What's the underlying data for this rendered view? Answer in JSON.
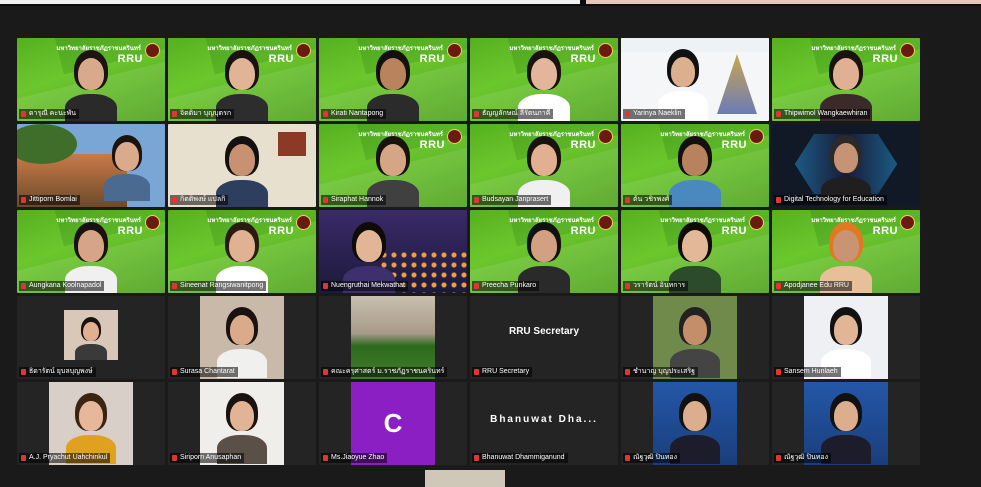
{
  "meeting": {
    "participants": [
      {
        "name": "ดารุณี คะนะพัน",
        "bg": "green",
        "skin": "#d8a98a",
        "hair": "#1c1410",
        "shirt": "#2a2a2a"
      },
      {
        "name": "จิตติมา บุญบุตรก",
        "bg": "green",
        "active": true,
        "skin": "#e0b595",
        "hair": "#1a1210",
        "shirt": "#2d2d2d"
      },
      {
        "name": "Kirati Nantapong",
        "bg": "green",
        "skin": "#b9835e",
        "hair": "#151010",
        "shirt": "#2b2b2b"
      },
      {
        "name": "ธัญญลักษณ์ ลีรัตนภาคี",
        "bg": "green",
        "skin": "#e3b69b",
        "hair": "#1a120e",
        "shirt": "#ffffff"
      },
      {
        "name": "Yarinya Naeklin",
        "bg": "light",
        "skin": "#dcb08e",
        "hair": "#111111",
        "shirt": "#ffffff"
      },
      {
        "name": "Thipwimol Wangkaewhiran",
        "bg": "green",
        "skin": "#e1b092",
        "hair": "#1a120e",
        "shirt": "#3a2a2a"
      },
      {
        "name": "Jittiporn Bomlai",
        "bg": "photo",
        "skin": "#d9ab8c",
        "hair": "#1b140e",
        "shirt": "#4a6a90"
      },
      {
        "name": "กิตติพงษ์ แปลกิ",
        "bg": "room",
        "skin": "#c89272",
        "hair": "#141010",
        "shirt": "#2e3e5e"
      },
      {
        "name": "Siraphat Hannok",
        "bg": "green",
        "skin": "#d5a686",
        "hair": "#1a120e",
        "shirt": "#404040"
      },
      {
        "name": "Budsayan Janprasert",
        "bg": "green",
        "skin": "#e0b090",
        "hair": "#1a120e",
        "shirt": "#f0f0f0"
      },
      {
        "name": "ต้น วชิรพงศ์",
        "bg": "green",
        "skin": "#b8825e",
        "hair": "#141010",
        "shirt": "#4a89c0"
      },
      {
        "name": "Digital Technology for Education",
        "bg": "tech",
        "skin": "#c69474",
        "hair": "#2a2a2a",
        "shirt": "#1f1f1f"
      },
      {
        "name": "Aungkana Koolnapadol",
        "bg": "green",
        "skin": "#d6a588",
        "hair": "#1a120e",
        "shirt": "#f0f0f0"
      },
      {
        "name": "Sineenat Rangsiwanitpong",
        "bg": "green",
        "skin": "#e1b194",
        "hair": "#2b1a10",
        "shirt": "#ffffff"
      },
      {
        "name": "Nuengruthai Mekwathat",
        "bg": "lights",
        "skin": "#e2b597",
        "hair": "#0f0b09",
        "shirt": "#3e2f6e"
      },
      {
        "name": "Preecha Punkaro",
        "bg": "green",
        "skin": "#d1a181",
        "hair": "#111111",
        "shirt": "#2a2a2a"
      },
      {
        "name": "วรารัตน์ อินทการ",
        "bg": "green",
        "skin": "#e3b898",
        "hair": "#100c0a",
        "shirt": "#2b4b2b"
      },
      {
        "name": "Apodjanee Edu RRU",
        "bg": "green",
        "skin": "#c99474",
        "hair": "#e07a20",
        "shirt": "#e7c09a"
      },
      {
        "name": "ธิดารัตน์ ยุบลบุญพงษ์",
        "bg": "small",
        "skin": "#e0b091",
        "hair": "#1a1210",
        "shirt": "#3a3a3a"
      },
      {
        "name": "Surasa Chantarat",
        "bg": "uniform",
        "skin": "#dbaa8b",
        "hair": "#1a1210",
        "shirt": "#f0f0ee"
      },
      {
        "name": "คณะครุศาสตร์ ม.ราชภัฏราชนครินทร์",
        "bg": "building",
        "skin": "",
        "hair": "",
        "shirt": ""
      },
      {
        "name": "RRU Secretary",
        "bg": "text",
        "label": "RRU Secretary"
      },
      {
        "name": "ชำนาญ บุญประเสริฐ",
        "bg": "photo2",
        "skin": "#c58e6b",
        "hair": "#222222",
        "shirt": "#444444"
      },
      {
        "name": "Sansem Hunlaeh",
        "bg": "portrait",
        "skin": "#e2b596",
        "hair": "#111111",
        "shirt": "#ffffff"
      },
      {
        "name": "A.J. Pryachut Uahchinkul",
        "bg": "portrait2",
        "skin": "#e6b79a",
        "hair": "#3a2412",
        "shirt": "#e0a020"
      },
      {
        "name": "Siriporn Anusaphan",
        "bg": "portrait3",
        "skin": "#e1b496",
        "hair": "#1a1210",
        "shirt": "#5a5048"
      },
      {
        "name": "Ms.Jiaoyue Zhao",
        "bg": "avatar",
        "letter": "C"
      },
      {
        "name": "Bhanuwat Dhammiganund",
        "bg": "text",
        "label": "Bhanuwat  Dha..."
      },
      {
        "name": "ณัฐวุฒิ ปิ่นทอง",
        "bg": "blueportrait",
        "skin": "#dcae8e",
        "hair": "#111111",
        "shirt": "#1c1c2a"
      },
      {
        "name": "ณัฐวุฒิ ปิ่นทอง",
        "bg": "blueportrait",
        "skin": "#dcae8e",
        "hair": "#111111",
        "shirt": "#1c1c2a"
      }
    ],
    "vbg_brand": "RRU",
    "vbg_title": "มหาวิทยาลัยราชภัฏราชนครินทร์"
  },
  "colors": {
    "active_outline": "#d4d452",
    "green": "#55b01f",
    "tile_bg": "#242424",
    "mic_off": "#e03535",
    "avatar_purple": "#8b1fc4"
  }
}
